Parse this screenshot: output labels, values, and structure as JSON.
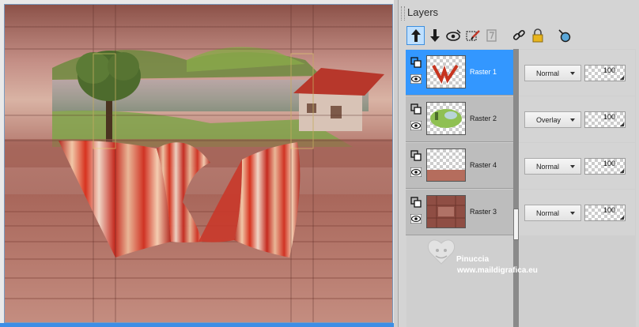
{
  "panel": {
    "title": "Layers",
    "toolbar": [
      {
        "icon": "move-layer-up-icon",
        "active": true
      },
      {
        "icon": "move-layer-down-icon",
        "active": false
      },
      {
        "icon": "visibility-toggle-icon",
        "active": false
      },
      {
        "icon": "edit-selection-icon",
        "active": false
      },
      {
        "icon": "mask-icon",
        "active": false
      },
      {
        "icon": "link-layer-icon",
        "active": false
      },
      {
        "icon": "lock-transparency-icon",
        "active": false
      },
      {
        "icon": "properties-icon",
        "active": false
      }
    ]
  },
  "layers": [
    {
      "name": "Raster 1",
      "blend": "Normal",
      "opacity": "100",
      "selected": true
    },
    {
      "name": "Raster 2",
      "blend": "Overlay",
      "opacity": "100",
      "selected": false
    },
    {
      "name": "Raster 4",
      "blend": "Normal",
      "opacity": "100",
      "selected": false
    },
    {
      "name": "Raster 3",
      "blend": "Normal",
      "opacity": "100",
      "selected": false
    }
  ],
  "watermark": {
    "name": "Pinuccia",
    "url": "www.maildigrafica.eu"
  },
  "colors": {
    "selection": "#3397ff",
    "canvas_tint": "#a8685e",
    "accent_red": "#d0352a"
  }
}
